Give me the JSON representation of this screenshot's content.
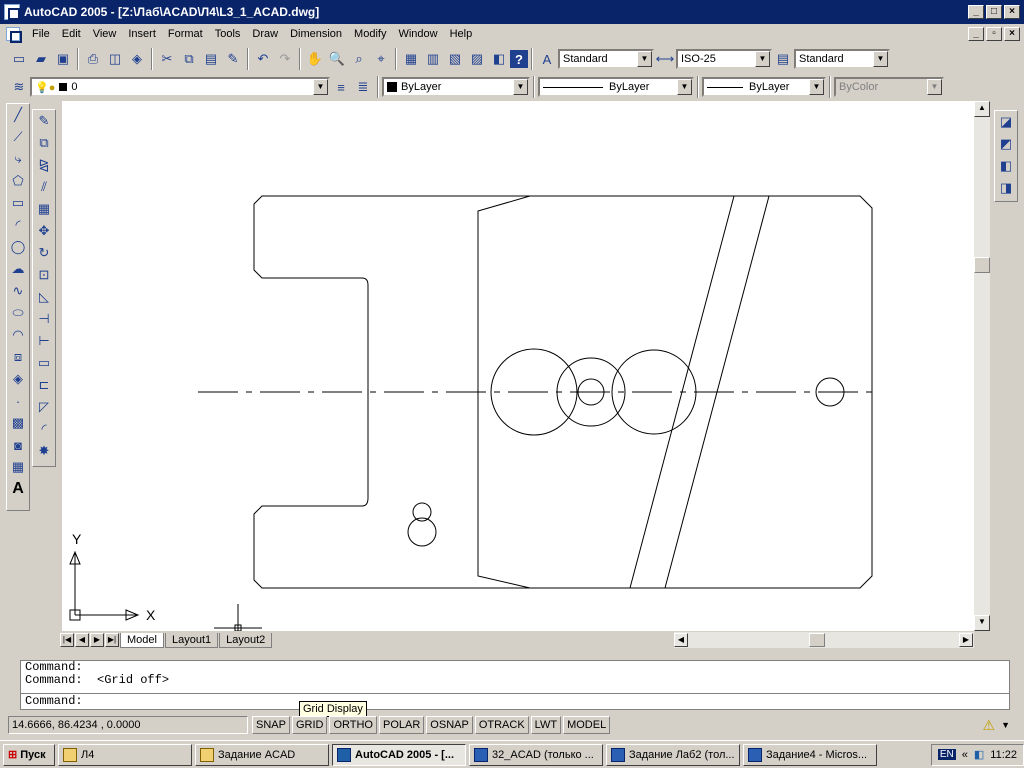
{
  "window": {
    "title": "AutoCAD 2005 - [Z:\\Лаб\\ACAD\\Л4\\L3_1_ACAD.dwg]"
  },
  "menu": [
    "File",
    "Edit",
    "View",
    "Insert",
    "Format",
    "Tools",
    "Draw",
    "Dimension",
    "Modify",
    "Window",
    "Help"
  ],
  "styles": {
    "text_style": "Standard",
    "dim_style": "ISO-25",
    "table_style": "Standard"
  },
  "layers": {
    "current_layer": "0",
    "color": "ByLayer",
    "linetype": "ByLayer",
    "lineweight": "ByLayer",
    "plotstyle": "ByColor"
  },
  "tabs": [
    "Model",
    "Layout1",
    "Layout2"
  ],
  "ucs": {
    "y_label": "Y",
    "x_label": "X"
  },
  "command": {
    "history": [
      "Command:",
      "Command:  <Grid off>"
    ],
    "prompt": "Command:"
  },
  "tooltip": "Grid Display",
  "status": {
    "coords": "14.6666,  86.4234 , 0.0000",
    "buttons": [
      "SNAP",
      "GRID",
      "ORTHO",
      "POLAR",
      "OSNAP",
      "OTRACK",
      "LWT",
      "MODEL"
    ]
  },
  "taskbar": {
    "start": "Пуск",
    "tasks": [
      "Л4",
      "Задание ACAD",
      "AutoCAD 2005 - [...",
      "32_ACAD (только ...",
      "Задание Лаб2 (тол...",
      "Задание4 - Micros..."
    ],
    "lang": "EN",
    "time": "11:22"
  }
}
